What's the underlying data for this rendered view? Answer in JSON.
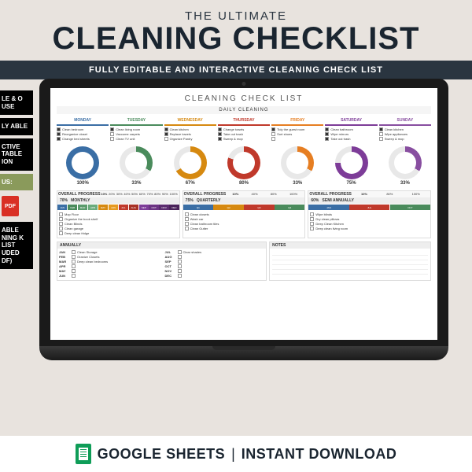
{
  "header": {
    "pretitle": "THE ULTIMATE",
    "title": "CLEANING CHECKLIST",
    "subtitle": "FULLY EDITABLE AND INTERACTIVE CLEANING CHECK LIST"
  },
  "side_tags": {
    "t1": "LE &\nO USE",
    "t2": "LY\nABLE",
    "t3": "CTIVE\nTABLE\nION",
    "bonus": "US:",
    "pdf": "PDF",
    "t4": "ABLE\nNING\nK LIST\nUDED\nDF)"
  },
  "sheet": {
    "title": "CLEANING CHECK LIST",
    "daily_header": "DAILY CLEANING",
    "days": [
      {
        "name": "MONDAY",
        "cls": "mon",
        "tasks": [
          "Clean bedroom",
          "Reorganize closet",
          "Change bed sheets"
        ],
        "checked": [
          true,
          true,
          true
        ],
        "pct": "100%",
        "donut": "conic-gradient(#3a6ea5 0 360deg)"
      },
      {
        "name": "TUESDAY",
        "cls": "tue",
        "tasks": [
          "Clean living room",
          "Vaccume carpets",
          "Clean TV unit"
        ],
        "checked": [
          true,
          false,
          false
        ],
        "pct": "33%",
        "donut": "conic-gradient(#4a8b5c 0 120deg,#e8e8e8 120deg 360deg)"
      },
      {
        "name": "WEDNESDAY",
        "cls": "wed",
        "tasks": [
          "Clean kitchen",
          "Replace towels",
          "Organize Pantry"
        ],
        "checked": [
          true,
          true,
          false
        ],
        "pct": "67%",
        "donut": "conic-gradient(#d68910 0 240deg,#e8e8e8 240deg 360deg)"
      },
      {
        "name": "THURSDAY",
        "cls": "thu",
        "tasks": [
          "Change towels",
          "Take out trash",
          "Sweep & mop"
        ],
        "checked": [
          true,
          true,
          true
        ],
        "pct": "80%",
        "donut": "conic-gradient(#c0392b 0 288deg,#e8e8e8 288deg 360deg)"
      },
      {
        "name": "FRIDAY",
        "cls": "fri",
        "tasks": [
          "Tidy the guest room",
          "Sort shoes",
          ""
        ],
        "checked": [
          true,
          false,
          false
        ],
        "pct": "33%",
        "donut": "conic-gradient(#e67e22 0 120deg,#e8e8e8 120deg 360deg)"
      },
      {
        "name": "SATURDAY",
        "cls": "sat",
        "tasks": [
          "Clean bathroom",
          "Wipe mirrors",
          "Take out trash"
        ],
        "checked": [
          true,
          true,
          true
        ],
        "pct": "75%",
        "donut": "conic-gradient(#7d3c98 0 270deg,#e8e8e8 270deg 360deg)"
      },
      {
        "name": "SUNDAY",
        "cls": "sun",
        "tasks": [
          "Clean kitchen",
          "Wipe appliances",
          "Sweep & mop"
        ],
        "checked": [
          true,
          false,
          false
        ],
        "pct": "33%",
        "donut": "conic-gradient(#884ea0 0 120deg,#e8e8e8 120deg 360deg)"
      }
    ],
    "overall_label": "OVERALL PROGRESS",
    "monthly": {
      "label": "MONTHLY",
      "pct": "70%",
      "scale": [
        "10%",
        "20%",
        "30%",
        "40%",
        "50%",
        "60%",
        "70%",
        "80%",
        "90%",
        "100%"
      ],
      "months": [
        "JAN",
        "FEB",
        "MAR",
        "APR",
        "MAY",
        "JUN",
        "JUL",
        "AUG",
        "SEP",
        "OCT",
        "NOV",
        "DEC"
      ],
      "month_colors": [
        "#3a6ea5",
        "#4a8b5c",
        "#5a9b6c",
        "#6aab7c",
        "#d68910",
        "#e6991f",
        "#c0392b",
        "#a93226",
        "#7d3c98",
        "#6c3483",
        "#5b2c6f",
        "#4a235a"
      ],
      "tasks": [
        "Mop Floor",
        "Organize the book shelf",
        "Clean Blinds",
        "Clean garage",
        "Deep clean fridge"
      ]
    },
    "quarterly": {
      "label": "QUARTERLY",
      "pct": "75%",
      "scale": [
        "10%",
        "40%",
        "80%",
        "100%"
      ],
      "months": [
        "Q1",
        "Q2",
        "Q3",
        "Q4"
      ],
      "month_colors": [
        "#3a6ea5",
        "#d68910",
        "#c0392b",
        "#4a8b5c"
      ],
      "tasks": [
        "Clean closets",
        "Wash car",
        "Clean bathroom tiles",
        "Clean Gutter"
      ]
    },
    "semi": {
      "label": "SEMI ANNUALLY",
      "pct": "60%",
      "scale": [
        "10%",
        "80%",
        "100%"
      ],
      "months": [
        "JAN",
        "JUL",
        "OCT"
      ],
      "month_colors": [
        "#3a6ea5",
        "#c0392b",
        "#4a8b5c"
      ],
      "tasks": [
        "Wipe blinds",
        "Dry clean pillows",
        "Deep Clean Kitchen",
        "Deep clean living room"
      ]
    },
    "annually": {
      "label": "ANNUALLY",
      "left": [
        [
          "JAN",
          "Clean Storage"
        ],
        [
          "FEB",
          "Oranize Closets"
        ],
        [
          "MAR",
          "Deep clean bedrooms"
        ],
        [
          "APR",
          ""
        ],
        [
          "MAY",
          ""
        ],
        [
          "JUN",
          ""
        ]
      ],
      "right": [
        [
          "JUL",
          "Clear shades"
        ],
        [
          "AUG",
          ""
        ],
        [
          "SEP",
          ""
        ],
        [
          "OCT",
          ""
        ],
        [
          "NOV",
          ""
        ],
        [
          "DEC",
          ""
        ]
      ]
    },
    "notes_label": "NOTES"
  },
  "footer": {
    "gs": "GOOGLE SHEETS",
    "dl": "INSTANT DOWNLOAD"
  }
}
